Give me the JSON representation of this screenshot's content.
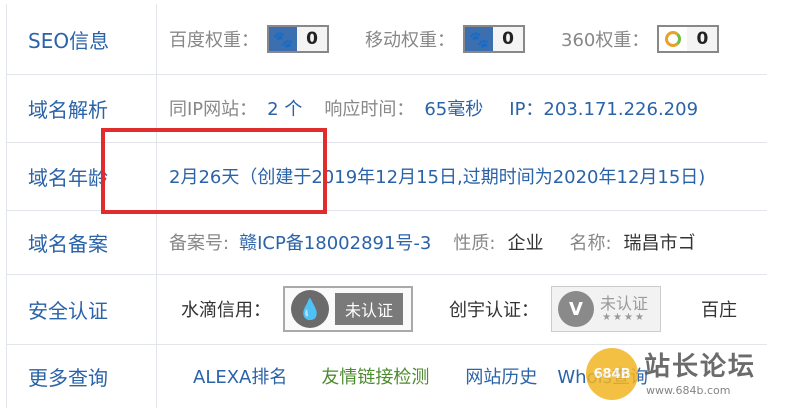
{
  "rows": {
    "seo": {
      "label": "SEO信息",
      "baidu_label": "百度权重：",
      "baidu_value": "0",
      "mobile_label": "移动权重：",
      "mobile_value": "0",
      "s360_label": "360权重：",
      "s360_value": "0"
    },
    "dns": {
      "label": "域名解析",
      "same_ip_label": "同IP网站：",
      "same_ip_value": "2 个",
      "response_label": "响应时间：",
      "response_value": "65毫秒",
      "ip_text": "IP：203.171.226.209"
    },
    "age": {
      "label": "域名年龄",
      "text": "2月26天（创建于2019年12月15日,过期时间为2020年12月15日)"
    },
    "icp": {
      "label": "域名备案",
      "record_label": "备案号:",
      "record_value": "赣ICP备18002891号-3",
      "nature_label": "性质:",
      "nature_value": "企业",
      "name_label": "名称:",
      "name_value": "瑞昌市ゴ"
    },
    "security": {
      "label": "安全认证",
      "shuidi_label": "水滴信用：",
      "shuidi_badge": "未认证",
      "chuangyu_label": "创宇认证：",
      "chuangyu_badge": "未认证",
      "chuangyu_stars": "★★★★",
      "chuangyu_icon": "V",
      "extra": "百庄"
    },
    "more": {
      "label": "更多查询",
      "links": [
        "ALEXA排名",
        "友情链接检测",
        "网站历史",
        "Whois查询"
      ]
    }
  },
  "icons": {
    "baidu": "paw-icon",
    "water": "water-drop-icon",
    "s360": "ring-icon"
  },
  "watermark": {
    "title": "站长论坛",
    "url": "www.684b.com",
    "logo_text": "684B"
  },
  "colors": {
    "label_blue": "#2a63a8",
    "green_link": "#4d8b2f",
    "highlight_red": "#e02c2c"
  }
}
